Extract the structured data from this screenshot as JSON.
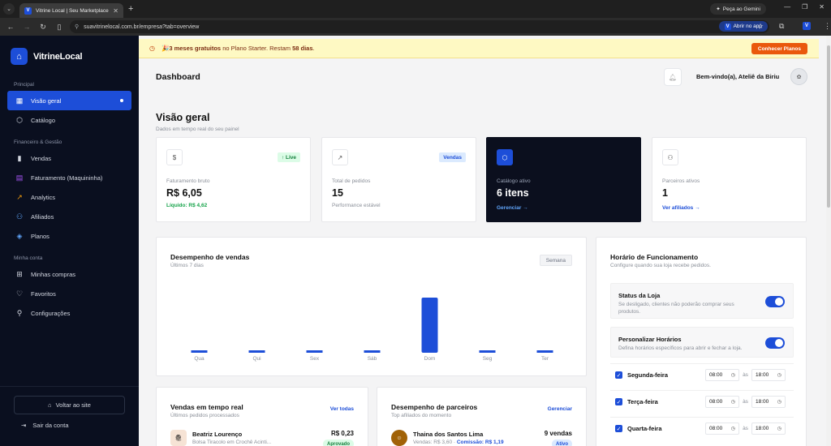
{
  "browser": {
    "tab_title": "Vitrine Local | Seu Marketplace",
    "gemini_label": "Peça ao Gemini",
    "url": "suavitrinelocal.com.br/empresa?tab=overview",
    "open_app_label": "Abrir no app"
  },
  "sidebar": {
    "brand": "VitrineLocal",
    "sections": {
      "principal": "Principal",
      "financeiro": "Financeiro & Gestão",
      "minha_conta": "Minha conta"
    },
    "items": [
      {
        "label": "Visão geral"
      },
      {
        "label": "Catálogo"
      },
      {
        "label": "Vendas"
      },
      {
        "label": "Faturamento (Maquininha)"
      },
      {
        "label": "Analytics"
      },
      {
        "label": "Afiliados"
      },
      {
        "label": "Planos"
      },
      {
        "label": "Minhas compras"
      },
      {
        "label": "Favoritos"
      },
      {
        "label": "Configurações"
      }
    ],
    "visit_store": "Voltar ao site",
    "logout": "Sair da conta"
  },
  "promo": {
    "prefix": "🎉 ",
    "highlight": "3 meses gratuitos",
    "middle": " no Plano Starter. Restam ",
    "days": "58 dias",
    "suffix": ".",
    "button": "Conhecer Planos"
  },
  "header": {
    "title": "Dashboard",
    "welcome": "Bem-vindo(a), Ateliê da Biriu"
  },
  "overview": {
    "title": "Visão geral",
    "subtitle": "Dados em tempo real do seu painel"
  },
  "stats": [
    {
      "icon": "dollar-icon",
      "badge": "↑ Live",
      "label": "Faturamento bruto",
      "value": "R$ 6,05",
      "sub": "Líquido: R$ 4,62"
    },
    {
      "icon": "trend-icon",
      "badge": "Vendas",
      "label": "Total de pedidos",
      "value": "15",
      "sub": "Performance estável"
    },
    {
      "icon": "box-icon",
      "label": "Catálogo ativo",
      "value": "6 itens",
      "link": "Gerenciar →"
    },
    {
      "icon": "users-icon",
      "label": "Parceiros ativos",
      "value": "1",
      "link": "Ver afiliados →"
    }
  ],
  "sales_chart": {
    "title": "Desempenho de vendas",
    "subtitle": "Últimos 7 dias",
    "range_button": "Semana"
  },
  "chart_data": {
    "type": "bar",
    "categories": [
      "Qua",
      "Qui",
      "Sex",
      "Sáb",
      "Dom",
      "Seg",
      "Ter"
    ],
    "values": [
      0,
      0,
      0,
      0,
      1,
      0,
      0
    ],
    "ylim": [
      0,
      1
    ]
  },
  "hours": {
    "title": "Horário de Funcionamento",
    "subtitle": "Configure quando sua loja recebe pedidos.",
    "status_title": "Status da Loja",
    "status_desc": "Se desligado, clientes não poderão comprar seus produtos.",
    "custom_title": "Personalizar Horários",
    "custom_desc": "Defina horários específicos para abrir e fechar a loja.",
    "sep": "às",
    "days": [
      {
        "name": "Segunda-feira",
        "open": "08:00",
        "close": "18:00"
      },
      {
        "name": "Terça-feira",
        "open": "08:00",
        "close": "18:00"
      },
      {
        "name": "Quarta-feira",
        "open": "08:00",
        "close": "18:00"
      }
    ]
  },
  "realtime": {
    "title": "Vendas em tempo real",
    "subtitle": "Últimos pedidos processados",
    "link": "Ver todas",
    "row": {
      "name": "Beatriz Lourenço",
      "desc": "Bolsa Tiracolo em Crochê Acinti...",
      "value": "R$ 0,23",
      "status": "Aprovado"
    }
  },
  "partners": {
    "title": "Desempenho de parceiros",
    "subtitle": "Top afiliados do momento",
    "link": "Gerenciar",
    "row": {
      "name": "Thaina dos Santos Lima",
      "sales": "Vendas: R$ 3,60",
      "sep": " · ",
      "commission": "Comissão: R$ 1,19",
      "count": "9 vendas",
      "status": "Ativo"
    }
  },
  "colors": {
    "accent": "#1d4ed8",
    "sidebar": "#0a0f1e",
    "promo_btn": "#ea580c"
  }
}
